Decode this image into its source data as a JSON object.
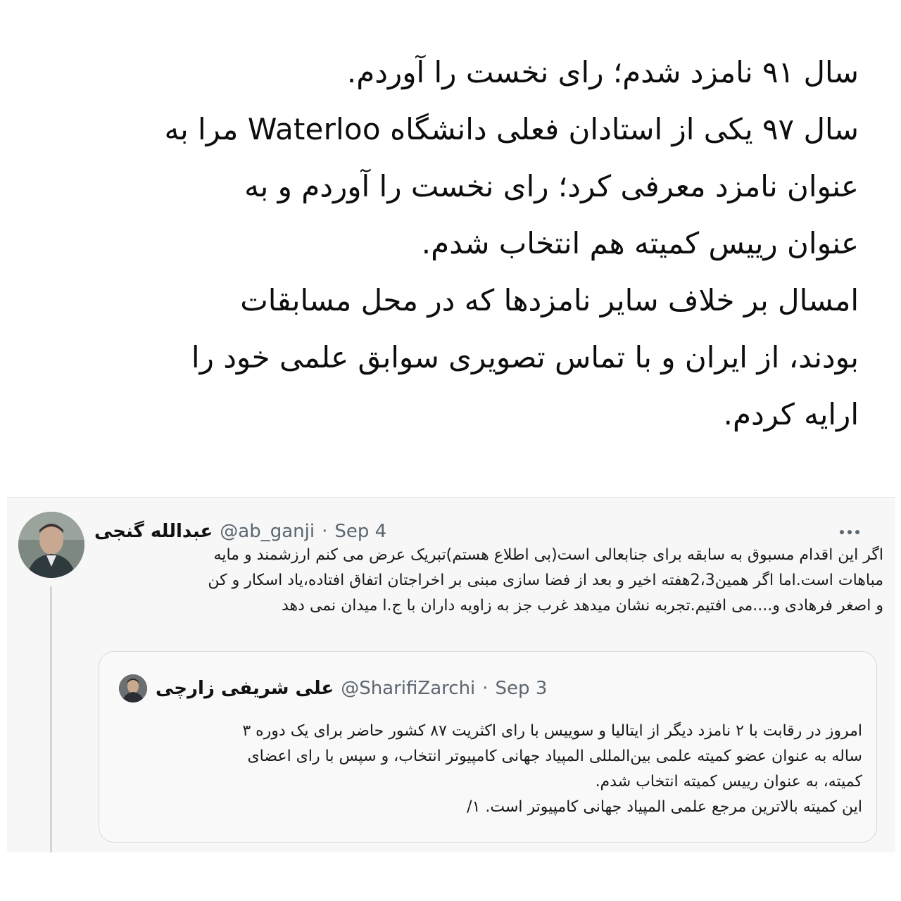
{
  "headline": {
    "lines": [
      "سال ۹۱ نامزد شدم؛ رای نخست را آوردم.",
      "سال ۹۷ یکی از استادان فعلی دانشگاه Waterloo مرا به",
      "عنوان نامزد معرفی کرد؛ رای نخست را آوردم و به",
      "عنوان رییس کمیته هم انتخاب شدم.",
      "امسال بر خلاف سایر نامزدها که در محل مسابقات",
      "بودند، از ایران و با تماس تصویری سوابق علمی خود را",
      "ارایه کردم."
    ]
  },
  "tweet": {
    "display_name": "عبدالله گنجی",
    "handle": "@ab_ganji",
    "separator": "·",
    "date": "Sep 4",
    "more_icon": "more-dots-icon",
    "body_lines": [
      "اگر این اقدام مسبوق به سابقه برای جنابعالی است(بی اطلاع هستم)تبریک عرض می کنم ارزشمند و مایه",
      "مباهات است.اما اگر همین2،3هفته اخیر و بعد از فضا سازی مبنی بر اخراجتان اتفاق افتاده،یاد اسکار و کن",
      "و اصغر فرهادی و....می افتیم.تجربه نشان میدهد غرب جز به زاویه داران با ج.ا میدان نمی دهد"
    ]
  },
  "quoted_tweet": {
    "display_name": "علی شریفی زارچی",
    "handle": "@SharifiZarchi",
    "separator": "·",
    "date": "Sep 3",
    "body_lines": [
      "امروز در رقابت با ۲ نامزد دیگر از ایتالیا و سوییس با رای اکثریت ۸۷ کشور حاضر برای یک دوره ۳",
      "ساله به عنوان عضو کمیته علمی بین‌المللی المپیاد جهانی کامپیوتر انتخاب، و سپس با رای اعضای",
      "کمیته، به عنوان رییس کمیته انتخاب شدم.",
      "این کمیته بالاترین مرجع علمی المپیاد جهانی کامپیوتر است. ۱/"
    ]
  },
  "colors": {
    "muted_text": "#5b6670",
    "card_bg": "#f7f7f7",
    "quote_border": "#d9d9d9",
    "thread_line": "#cfd6dc"
  }
}
